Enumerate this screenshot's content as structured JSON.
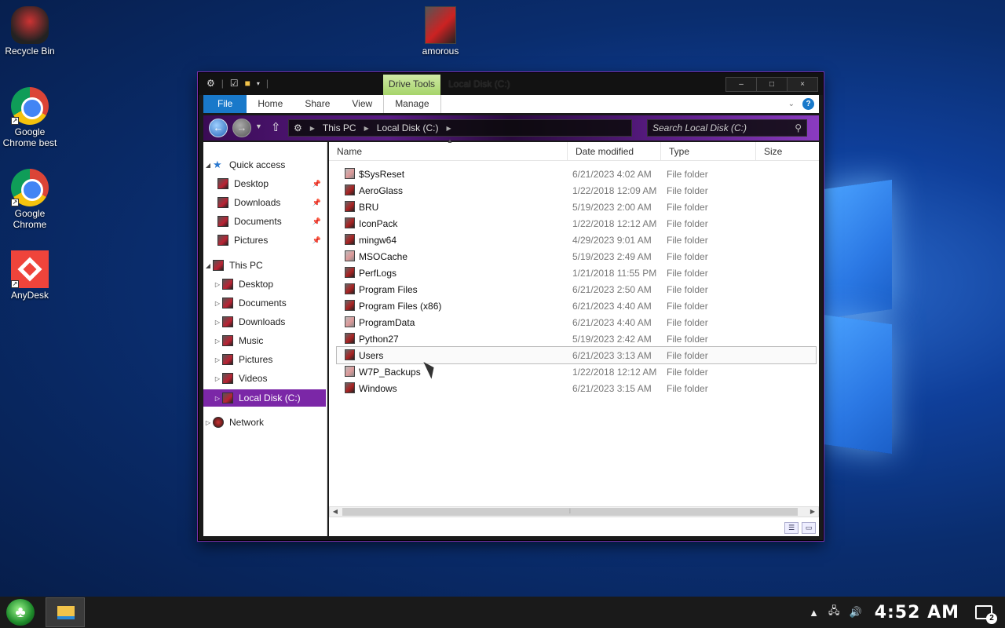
{
  "desktop": {
    "icons": [
      {
        "label": "Recycle Bin",
        "icon": "recycle-bin-icon"
      },
      {
        "label": "Google\nChrome best",
        "icon": "chrome-icon"
      },
      {
        "label": "Google\nChrome",
        "icon": "chrome-icon"
      },
      {
        "label": "AnyDesk",
        "icon": "anydesk-icon"
      },
      {
        "label": "amorous",
        "icon": "folder-icon"
      }
    ]
  },
  "window": {
    "title": "Local Disk (C:)",
    "context_tab": "Drive Tools",
    "caption": {
      "minimize": "–",
      "maximize": "□",
      "close": "×"
    },
    "ribbon_tabs": [
      "File",
      "Home",
      "Share",
      "View",
      "Manage"
    ],
    "help": "?",
    "address": {
      "crumbs": [
        "This PC",
        "Local Disk (C:)"
      ]
    },
    "search_placeholder": "Search Local Disk (C:)"
  },
  "navpane": {
    "quick_access": {
      "label": "Quick access",
      "items": [
        "Desktop",
        "Downloads",
        "Documents",
        "Pictures"
      ]
    },
    "this_pc": {
      "label": "This PC",
      "items": [
        "Desktop",
        "Documents",
        "Downloads",
        "Music",
        "Pictures",
        "Videos",
        "Local Disk (C:)"
      ],
      "selected": "Local Disk (C:)"
    },
    "network": "Network"
  },
  "columns": [
    "Name",
    "Date modified",
    "Type",
    "Size"
  ],
  "files": [
    {
      "name": "$SysReset",
      "date": "6/21/2023 4:02 AM",
      "type": "File folder",
      "light": true
    },
    {
      "name": "AeroGlass",
      "date": "1/22/2018 12:09 AM",
      "type": "File folder",
      "light": false
    },
    {
      "name": "BRU",
      "date": "5/19/2023 2:00 AM",
      "type": "File folder",
      "light": false
    },
    {
      "name": "IconPack",
      "date": "1/22/2018 12:12 AM",
      "type": "File folder",
      "light": false
    },
    {
      "name": "mingw64",
      "date": "4/29/2023 9:01 AM",
      "type": "File folder",
      "light": false
    },
    {
      "name": "MSOCache",
      "date": "5/19/2023 2:49 AM",
      "type": "File folder",
      "light": true
    },
    {
      "name": "PerfLogs",
      "date": "1/21/2018 11:55 PM",
      "type": "File folder",
      "light": false
    },
    {
      "name": "Program Files",
      "date": "6/21/2023 2:50 AM",
      "type": "File folder",
      "light": false
    },
    {
      "name": "Program Files (x86)",
      "date": "6/21/2023 4:40 AM",
      "type": "File folder",
      "light": false
    },
    {
      "name": "ProgramData",
      "date": "6/21/2023 4:40 AM",
      "type": "File folder",
      "light": true
    },
    {
      "name": "Python27",
      "date": "5/19/2023 2:42 AM",
      "type": "File folder",
      "light": false
    },
    {
      "name": "Users",
      "date": "6/21/2023 3:13 AM",
      "type": "File folder",
      "light": false,
      "hover": true
    },
    {
      "name": "W7P_Backups",
      "date": "1/22/2018 12:12 AM",
      "type": "File folder",
      "light": true
    },
    {
      "name": "Windows",
      "date": "6/21/2023 3:15 AM",
      "type": "File folder",
      "light": false
    }
  ],
  "taskbar": {
    "clock": "4:52 AM",
    "notification_count": "2"
  },
  "colors": {
    "accent_purple": "#7b27a7",
    "file_tab_blue": "#1979ca",
    "drive_tools_green": "#a6d46a"
  }
}
